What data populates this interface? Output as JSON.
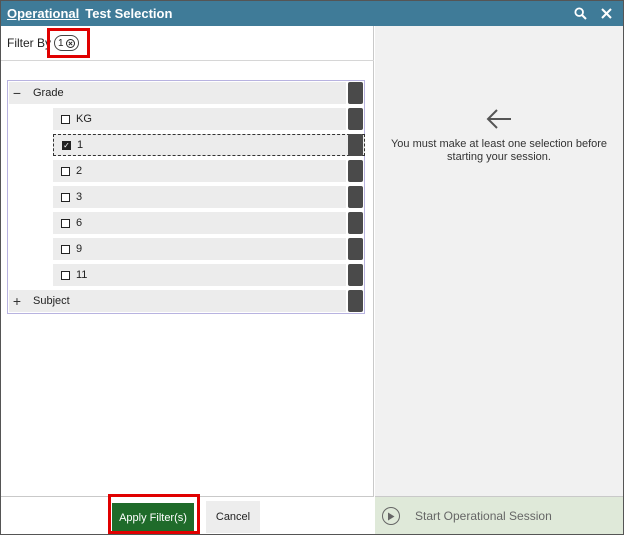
{
  "header": {
    "title_link": "Operational",
    "title": "Test Selection",
    "search_icon": "search-icon",
    "close_icon": "close-icon"
  },
  "filter": {
    "label": "Filter By",
    "count": "1"
  },
  "tree": {
    "grade": {
      "toggle": "−",
      "label": "Grade",
      "options": [
        {
          "label": "KG",
          "checked": false
        },
        {
          "label": "1",
          "checked": true
        },
        {
          "label": "2",
          "checked": false
        },
        {
          "label": "3",
          "checked": false
        },
        {
          "label": "6",
          "checked": false
        },
        {
          "label": "9",
          "checked": false
        },
        {
          "label": "11",
          "checked": false
        }
      ]
    },
    "subject": {
      "toggle": "+",
      "label": "Subject"
    }
  },
  "right": {
    "hint": "You must make at least one selection before starting your session."
  },
  "footer": {
    "apply_label": "Apply Filter(s)",
    "cancel_label": "Cancel",
    "start_label": "Start Operational Session"
  },
  "colors": {
    "header": "#3f7b98",
    "apply": "#1f6b2a",
    "highlight": "#e00000"
  }
}
